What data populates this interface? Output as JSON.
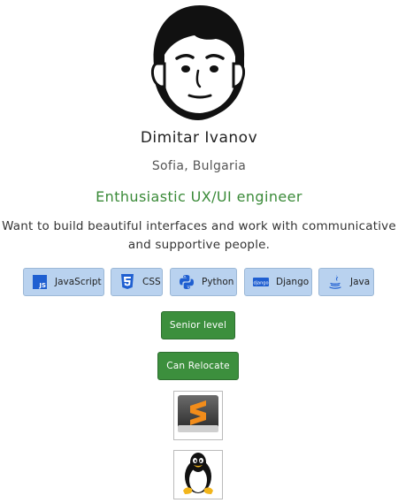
{
  "profile": {
    "name": "Dimitar Ivanov",
    "location": "Sofia, Bulgaria",
    "headline": "Enthusiastic UX/UI engineer",
    "bio_line1": "Want to build beautiful interfaces and work with communicative",
    "bio_line2": "and supportive people."
  },
  "skills": [
    {
      "label": "JavaScript",
      "icon": "javascript-icon"
    },
    {
      "label": "CSS",
      "icon": "css3-icon"
    },
    {
      "label": "Python",
      "icon": "python-icon"
    },
    {
      "label": "Django",
      "icon": "django-icon"
    },
    {
      "label": "Java",
      "icon": "java-icon"
    }
  ],
  "badges": {
    "level": "Senior level",
    "relocate": "Can Relocate"
  },
  "tools": [
    {
      "icon": "sublime-text-icon"
    },
    {
      "icon": "linux-tux-icon"
    }
  ],
  "colors": {
    "accent_green": "#3c8f3d",
    "headline_green": "#3a8a38",
    "skill_bg": "#b9d2ef",
    "skill_icon_blue": "#1f5fd1"
  }
}
